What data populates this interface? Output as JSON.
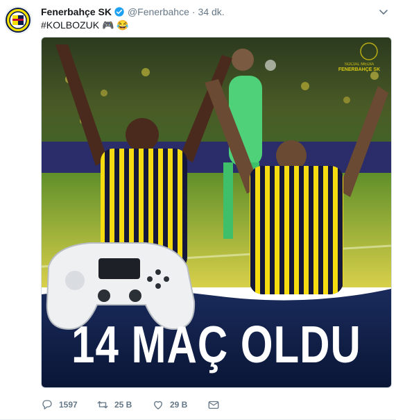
{
  "tweet": {
    "author_name": "Fenerbahçe SK",
    "handle": "@Fenerbahce",
    "separator": "·",
    "time": "34 dk.",
    "text": "#KOLBOZUK",
    "emojis": "🎮 😂"
  },
  "media": {
    "headline": "14 MAÇ OLDU",
    "watermark_line1": "SOCIAL MEDIA",
    "watermark_line2": "FENERBAHÇE SK"
  },
  "actions": {
    "reply_count": "1597",
    "retweet_count": "25 B",
    "like_count": "29 B"
  },
  "icons": {
    "verified": "verified-badge-icon",
    "caret": "chevron-down-icon",
    "reply": "reply-icon",
    "retweet": "retweet-icon",
    "like": "heart-icon",
    "dm": "envelope-icon"
  },
  "colors": {
    "verified": "#1da1f2",
    "muted": "#657786",
    "club_yellow": "#f5e100",
    "club_navy": "#0a1a4a"
  }
}
